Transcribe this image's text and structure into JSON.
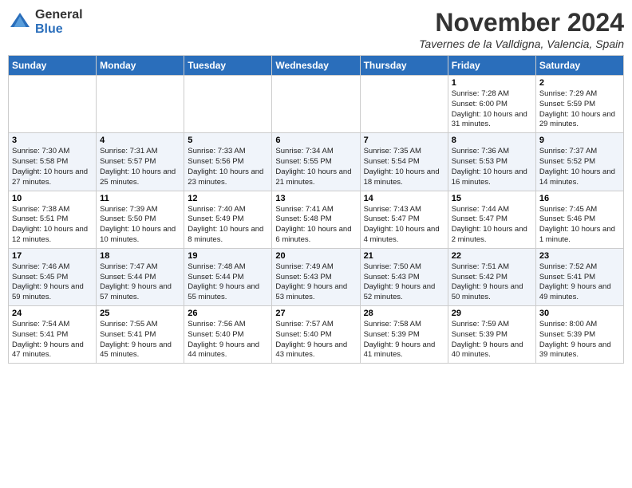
{
  "header": {
    "logo_general": "General",
    "logo_blue": "Blue",
    "month_year": "November 2024",
    "location": "Tavernes de la Valldigna, Valencia, Spain"
  },
  "weekdays": [
    "Sunday",
    "Monday",
    "Tuesday",
    "Wednesday",
    "Thursday",
    "Friday",
    "Saturday"
  ],
  "weeks": [
    [
      {
        "day": "",
        "info": ""
      },
      {
        "day": "",
        "info": ""
      },
      {
        "day": "",
        "info": ""
      },
      {
        "day": "",
        "info": ""
      },
      {
        "day": "",
        "info": ""
      },
      {
        "day": "1",
        "info": "Sunrise: 7:28 AM\nSunset: 6:00 PM\nDaylight: 10 hours and 31 minutes."
      },
      {
        "day": "2",
        "info": "Sunrise: 7:29 AM\nSunset: 5:59 PM\nDaylight: 10 hours and 29 minutes."
      }
    ],
    [
      {
        "day": "3",
        "info": "Sunrise: 7:30 AM\nSunset: 5:58 PM\nDaylight: 10 hours and 27 minutes."
      },
      {
        "day": "4",
        "info": "Sunrise: 7:31 AM\nSunset: 5:57 PM\nDaylight: 10 hours and 25 minutes."
      },
      {
        "day": "5",
        "info": "Sunrise: 7:33 AM\nSunset: 5:56 PM\nDaylight: 10 hours and 23 minutes."
      },
      {
        "day": "6",
        "info": "Sunrise: 7:34 AM\nSunset: 5:55 PM\nDaylight: 10 hours and 21 minutes."
      },
      {
        "day": "7",
        "info": "Sunrise: 7:35 AM\nSunset: 5:54 PM\nDaylight: 10 hours and 18 minutes."
      },
      {
        "day": "8",
        "info": "Sunrise: 7:36 AM\nSunset: 5:53 PM\nDaylight: 10 hours and 16 minutes."
      },
      {
        "day": "9",
        "info": "Sunrise: 7:37 AM\nSunset: 5:52 PM\nDaylight: 10 hours and 14 minutes."
      }
    ],
    [
      {
        "day": "10",
        "info": "Sunrise: 7:38 AM\nSunset: 5:51 PM\nDaylight: 10 hours and 12 minutes."
      },
      {
        "day": "11",
        "info": "Sunrise: 7:39 AM\nSunset: 5:50 PM\nDaylight: 10 hours and 10 minutes."
      },
      {
        "day": "12",
        "info": "Sunrise: 7:40 AM\nSunset: 5:49 PM\nDaylight: 10 hours and 8 minutes."
      },
      {
        "day": "13",
        "info": "Sunrise: 7:41 AM\nSunset: 5:48 PM\nDaylight: 10 hours and 6 minutes."
      },
      {
        "day": "14",
        "info": "Sunrise: 7:43 AM\nSunset: 5:47 PM\nDaylight: 10 hours and 4 minutes."
      },
      {
        "day": "15",
        "info": "Sunrise: 7:44 AM\nSunset: 5:47 PM\nDaylight: 10 hours and 2 minutes."
      },
      {
        "day": "16",
        "info": "Sunrise: 7:45 AM\nSunset: 5:46 PM\nDaylight: 10 hours and 1 minute."
      }
    ],
    [
      {
        "day": "17",
        "info": "Sunrise: 7:46 AM\nSunset: 5:45 PM\nDaylight: 9 hours and 59 minutes."
      },
      {
        "day": "18",
        "info": "Sunrise: 7:47 AM\nSunset: 5:44 PM\nDaylight: 9 hours and 57 minutes."
      },
      {
        "day": "19",
        "info": "Sunrise: 7:48 AM\nSunset: 5:44 PM\nDaylight: 9 hours and 55 minutes."
      },
      {
        "day": "20",
        "info": "Sunrise: 7:49 AM\nSunset: 5:43 PM\nDaylight: 9 hours and 53 minutes."
      },
      {
        "day": "21",
        "info": "Sunrise: 7:50 AM\nSunset: 5:43 PM\nDaylight: 9 hours and 52 minutes."
      },
      {
        "day": "22",
        "info": "Sunrise: 7:51 AM\nSunset: 5:42 PM\nDaylight: 9 hours and 50 minutes."
      },
      {
        "day": "23",
        "info": "Sunrise: 7:52 AM\nSunset: 5:41 PM\nDaylight: 9 hours and 49 minutes."
      }
    ],
    [
      {
        "day": "24",
        "info": "Sunrise: 7:54 AM\nSunset: 5:41 PM\nDaylight: 9 hours and 47 minutes."
      },
      {
        "day": "25",
        "info": "Sunrise: 7:55 AM\nSunset: 5:41 PM\nDaylight: 9 hours and 45 minutes."
      },
      {
        "day": "26",
        "info": "Sunrise: 7:56 AM\nSunset: 5:40 PM\nDaylight: 9 hours and 44 minutes."
      },
      {
        "day": "27",
        "info": "Sunrise: 7:57 AM\nSunset: 5:40 PM\nDaylight: 9 hours and 43 minutes."
      },
      {
        "day": "28",
        "info": "Sunrise: 7:58 AM\nSunset: 5:39 PM\nDaylight: 9 hours and 41 minutes."
      },
      {
        "day": "29",
        "info": "Sunrise: 7:59 AM\nSunset: 5:39 PM\nDaylight: 9 hours and 40 minutes."
      },
      {
        "day": "30",
        "info": "Sunrise: 8:00 AM\nSunset: 5:39 PM\nDaylight: 9 hours and 39 minutes."
      }
    ]
  ]
}
